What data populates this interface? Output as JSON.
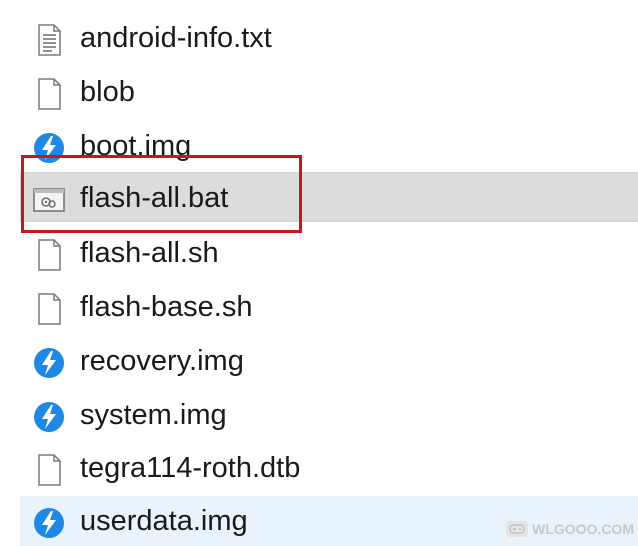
{
  "files": [
    {
      "name": "android-info.txt",
      "icon": "text-file-icon",
      "state": "normal"
    },
    {
      "name": "blob",
      "icon": "blank-file-icon",
      "state": "normal"
    },
    {
      "name": "boot.img",
      "icon": "flash-image-icon",
      "state": "normal"
    },
    {
      "name": "flash-all.bat",
      "icon": "batch-file-icon",
      "state": "selected"
    },
    {
      "name": "flash-all.sh",
      "icon": "blank-file-icon",
      "state": "normal"
    },
    {
      "name": "flash-base.sh",
      "icon": "blank-file-icon",
      "state": "normal"
    },
    {
      "name": "recovery.img",
      "icon": "flash-image-icon",
      "state": "normal"
    },
    {
      "name": "system.img",
      "icon": "flash-image-icon",
      "state": "normal"
    },
    {
      "name": "tegra114-roth.dtb",
      "icon": "blank-file-icon",
      "state": "normal"
    },
    {
      "name": "userdata.img",
      "icon": "flash-image-icon",
      "state": "hover"
    }
  ],
  "watermark": {
    "text": "WLGOOO.COM"
  },
  "colors": {
    "selected_bg": "#dcdcdc",
    "hover_bg": "#e8f3fc",
    "highlight_border": "#c9161d",
    "flash_icon": "#1e88e5"
  }
}
